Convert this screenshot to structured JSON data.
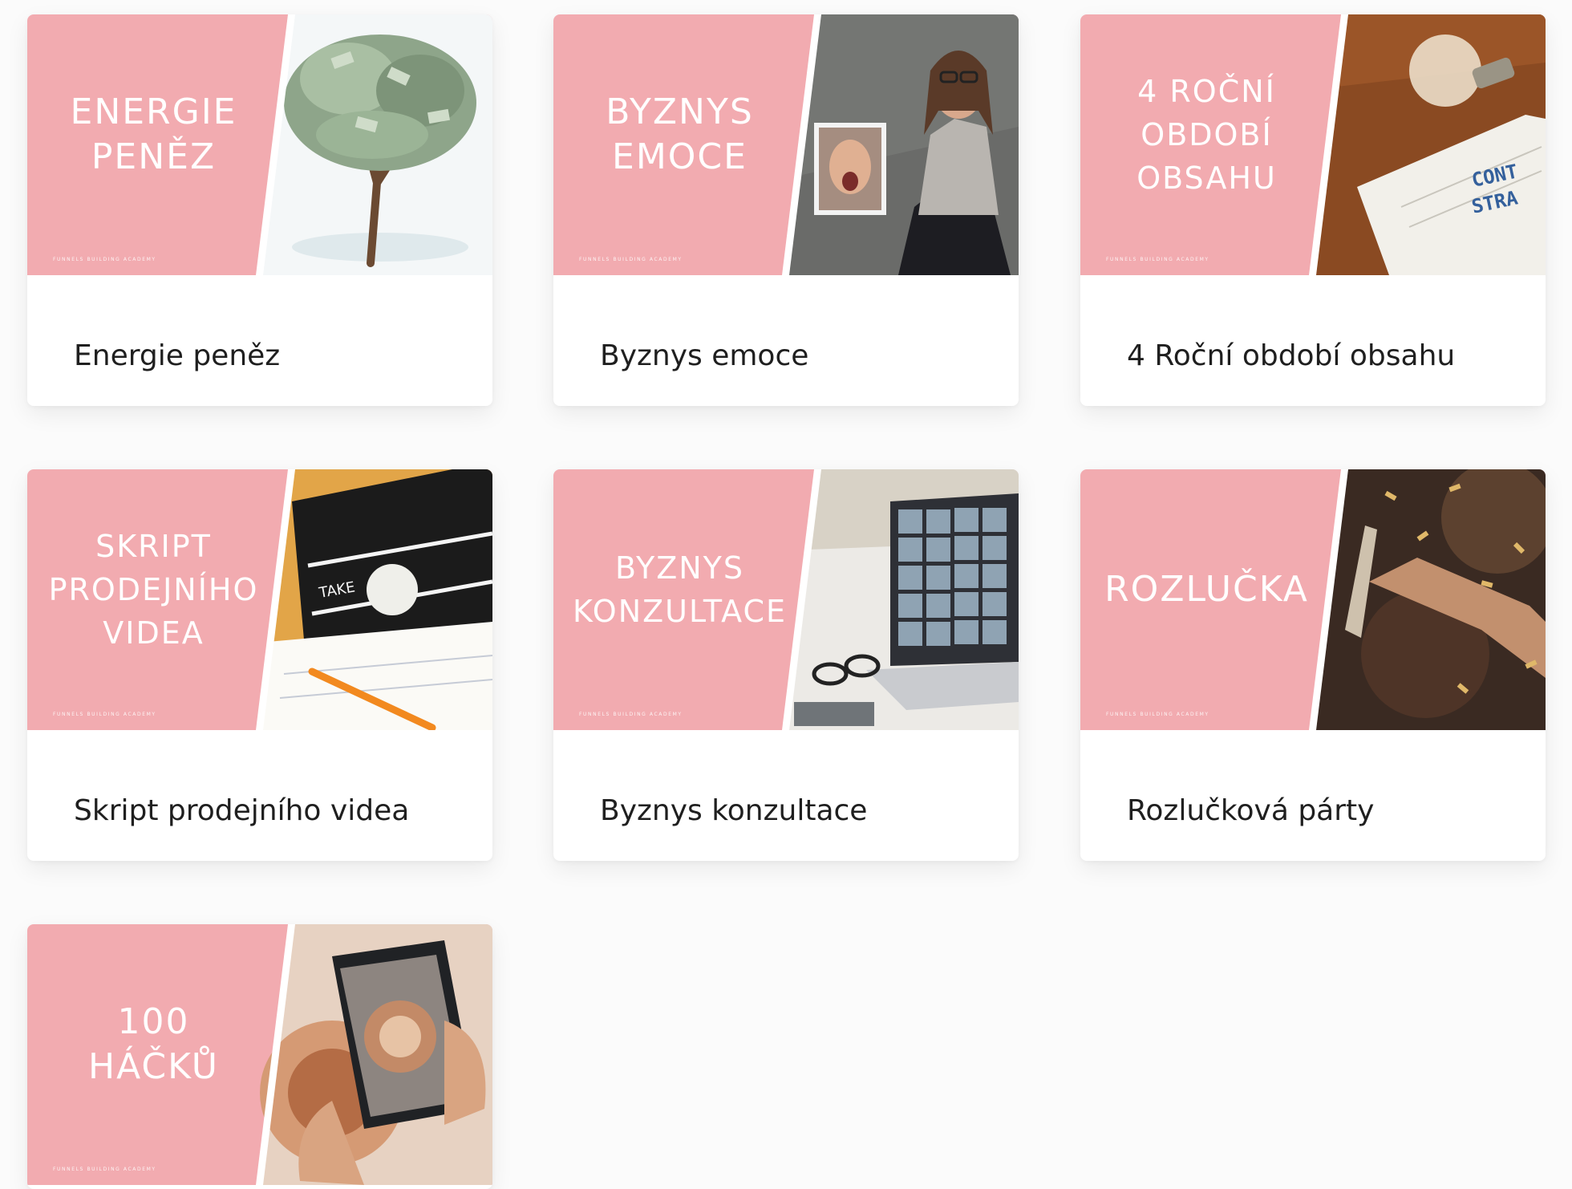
{
  "theme": {
    "card_pink": "#f2abb0",
    "label_color": "#1f1f1f",
    "page_background": "#fbfbfb"
  },
  "cards": [
    {
      "thumbnail_title": "ENERGIE\nPENĚZ",
      "thumbnail_brand": "FUNNELS BUILDING ACADEMY",
      "label": "Energie peněz",
      "image_subject": "money-tree"
    },
    {
      "thumbnail_title": "BYZNYS\nEMOCE",
      "thumbnail_brand": "FUNNELS BUILDING ACADEMY",
      "label": "Byznys emoce",
      "image_subject": "woman-with-photo"
    },
    {
      "thumbnail_title": "4 ROČNÍ\nOBDOBÍ\nOBSAHU",
      "thumbnail_brand": "FUNNELS BUILDING ACADEMY",
      "label": "4 Roční období obsahu",
      "image_subject": "light-bulb-and-notebook"
    },
    {
      "thumbnail_title": "SKRIPT\nPRODEJNÍHO\nVIDEA",
      "thumbnail_brand": "FUNNELS BUILDING ACADEMY",
      "label": "Skript prodejního videa",
      "image_subject": "clapperboard"
    },
    {
      "thumbnail_title": "BYZNYS\nKONZULTACE",
      "thumbnail_brand": "FUNNELS BUILDING ACADEMY",
      "label": "Byznys konzultace",
      "image_subject": "video-call-laptop"
    },
    {
      "thumbnail_title": "ROZLUČKA",
      "thumbnail_brand": "FUNNELS BUILDING ACADEMY",
      "label": "Rozlučková párty",
      "image_subject": "party-confetti"
    },
    {
      "thumbnail_title": "100\nHÁČKŮ",
      "thumbnail_brand": "FUNNELS BUILDING ACADEMY",
      "label": "",
      "image_subject": "phone-photo-coffee"
    }
  ]
}
